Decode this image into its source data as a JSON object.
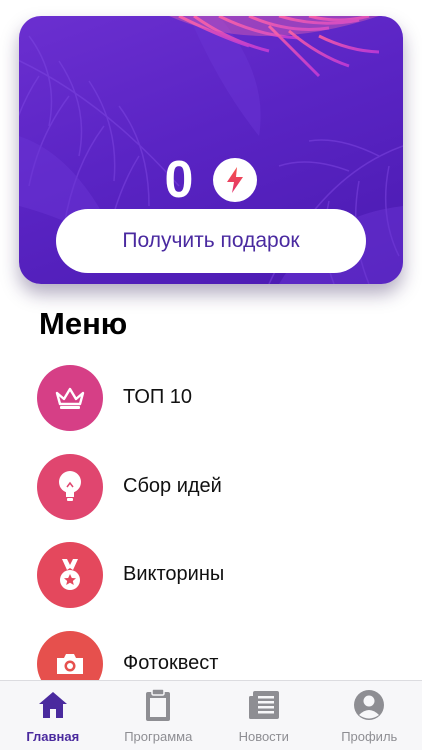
{
  "hero": {
    "count": "0",
    "gift_button": "Получить подарок",
    "bolt_icon": "lightning-bolt-icon"
  },
  "menu": {
    "title": "Меню",
    "items": [
      {
        "label": "ТОП 10",
        "icon": "crown-icon",
        "color": "#d63f86"
      },
      {
        "label": "Сбор идей",
        "icon": "lightbulb-icon",
        "color": "#e0466f"
      },
      {
        "label": "Викторины",
        "icon": "medal-icon",
        "color": "#e4485d"
      },
      {
        "label": "Фотоквест",
        "icon": "camera-icon",
        "color": "#e6504d"
      }
    ]
  },
  "tabbar": {
    "tabs": [
      {
        "label": "Главная",
        "icon": "home-icon",
        "active": true
      },
      {
        "label": "Программа",
        "icon": "clipboard-icon",
        "active": false
      },
      {
        "label": "Новости",
        "icon": "newspaper-icon",
        "active": false
      },
      {
        "label": "Профиль",
        "icon": "profile-icon",
        "active": false
      }
    ]
  },
  "colors": {
    "accent": "#4a2a9e",
    "hero_gradient": "#5a24c4",
    "inactive_tab": "#8e8e93"
  }
}
